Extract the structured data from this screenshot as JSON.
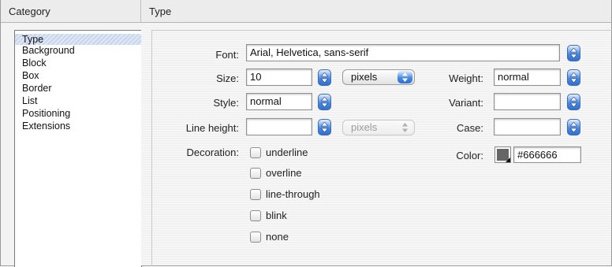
{
  "headers": {
    "category": "Category",
    "type": "Type"
  },
  "categories": [
    "Type",
    "Background",
    "Block",
    "Box",
    "Border",
    "List",
    "Positioning",
    "Extensions"
  ],
  "selected_category": "Type",
  "form": {
    "font": {
      "label": "Font:",
      "value": "Arial, Helvetica, sans-serif"
    },
    "size": {
      "label": "Size:",
      "value": "10",
      "unit": "pixels"
    },
    "weight": {
      "label": "Weight:",
      "value": "normal"
    },
    "style": {
      "label": "Style:",
      "value": "normal"
    },
    "variant": {
      "label": "Variant:",
      "value": ""
    },
    "line_height": {
      "label": "Line height:",
      "value": "",
      "unit": "pixels"
    },
    "case": {
      "label": "Case:",
      "value": ""
    },
    "decoration": {
      "label": "Decoration:",
      "options": [
        "underline",
        "overline",
        "line-through",
        "blink",
        "none"
      ]
    },
    "color": {
      "label": "Color:",
      "value": "#666666",
      "swatch": "#666666"
    }
  },
  "icons": {
    "spinner": "up-down-arrows-icon",
    "color_picker": "color-swatch-icon"
  }
}
